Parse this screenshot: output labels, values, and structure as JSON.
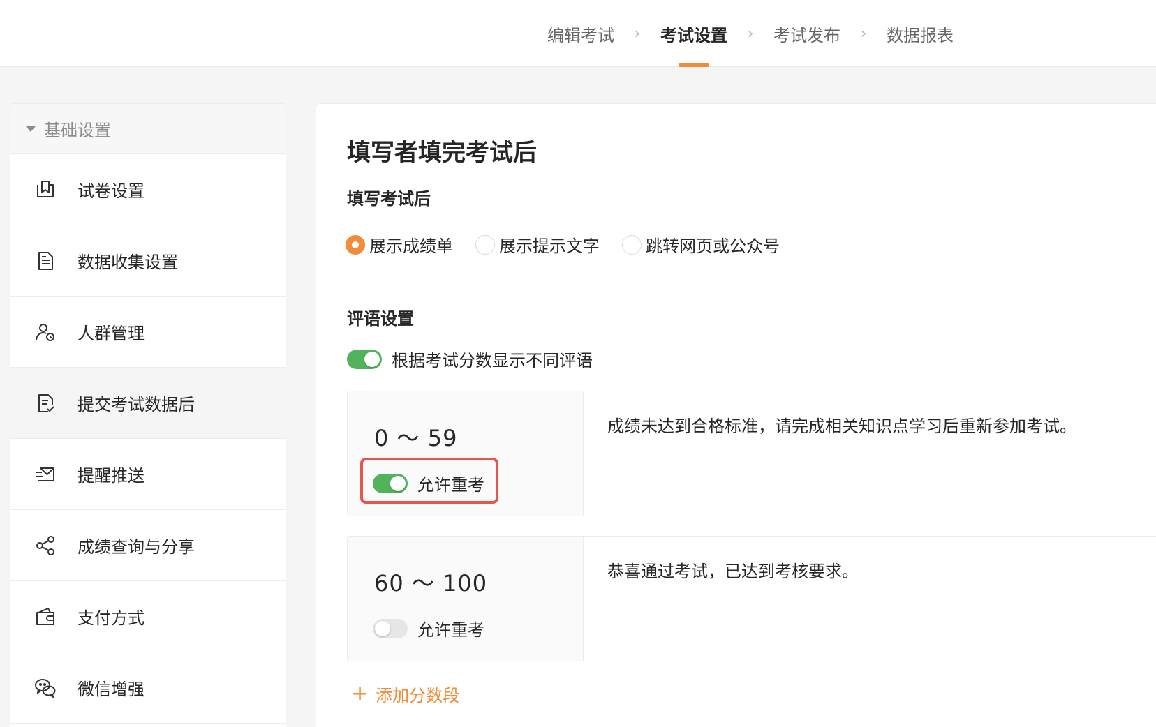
{
  "steps": [
    {
      "label": "编辑考试"
    },
    {
      "label": "考试设置"
    },
    {
      "label": "考试发布"
    },
    {
      "label": "数据报表"
    }
  ],
  "sidebar": {
    "group_title": "基础设置",
    "items": [
      {
        "label": "试卷设置",
        "icon": "paper-settings-icon"
      },
      {
        "label": "数据收集设置",
        "icon": "document-icon"
      },
      {
        "label": "人群管理",
        "icon": "user-group-icon"
      },
      {
        "label": "提交考试数据后",
        "icon": "submit-document-icon"
      },
      {
        "label": "提醒推送",
        "icon": "mail-push-icon"
      },
      {
        "label": "成绩查询与分享",
        "icon": "share-icon"
      },
      {
        "label": "支付方式",
        "icon": "wallet-icon"
      },
      {
        "label": "微信增强",
        "icon": "wechat-icon"
      }
    ]
  },
  "main": {
    "title": "填写者填完考试后",
    "after_fill": {
      "label": "填写考试后",
      "options": [
        {
          "label": "展示成绩单",
          "selected": true
        },
        {
          "label": "展示提示文字",
          "selected": false
        },
        {
          "label": "跳转网页或公众号",
          "selected": false
        }
      ]
    },
    "comments": {
      "label": "评语设置",
      "toggle_label": "根据考试分数显示不同评语",
      "toggle_on": true,
      "segments": [
        {
          "range": "0 ～ 59",
          "retake_label": "允许重考",
          "retake_on": true,
          "comment": "成绩未达到合格标准，请完成相关知识点学习后重新参加考试。"
        },
        {
          "range": "60 ～ 100",
          "retake_label": "允许重考",
          "retake_on": false,
          "comment": "恭喜通过考试，已达到考核要求。"
        }
      ],
      "add_segment_label": "添加分数段"
    }
  },
  "colors": {
    "accent": "#f28c38",
    "toggle_on": "#52b35a",
    "highlight": "#e8554a"
  }
}
